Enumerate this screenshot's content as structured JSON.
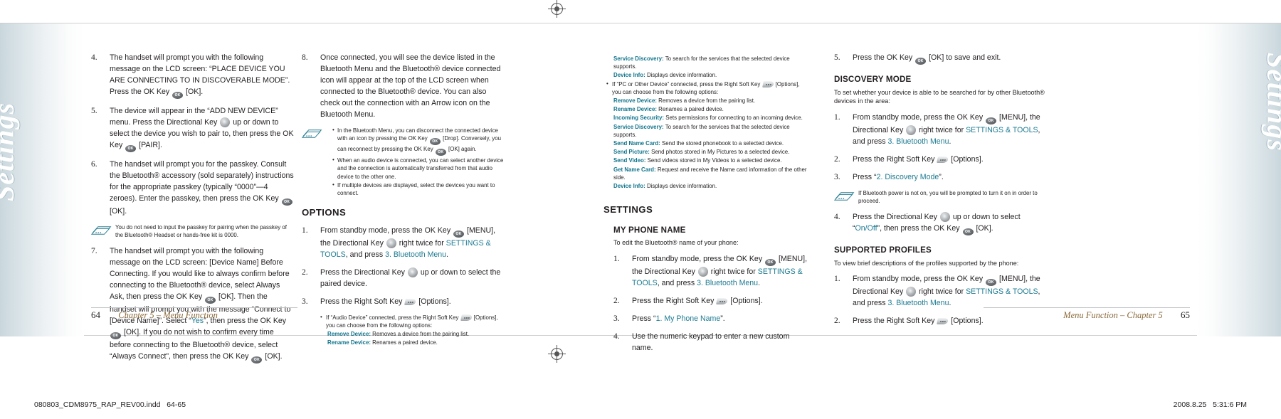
{
  "spread": {
    "side_tab_label": "Settings",
    "teal_color": "#1d7b92",
    "running_head_color": "#8a6a3b"
  },
  "slug": {
    "left": "080803_CDM8975_RAP_REV00.indd   64-65",
    "right": "2008.8.25   5:31:6 PM"
  },
  "footer": {
    "left_page_number": "64",
    "left_running_head": "Chapter 5 – Menu Function",
    "right_page_number": "65",
    "right_running_head": "Menu Function – Chapter 5"
  },
  "icons": {
    "ok_key": "ok-key-icon",
    "ok_key_label": "OK",
    "directional_key": "directional-key-icon",
    "right_soft_key": "right-soft-key-icon",
    "note": "note-pad-icon",
    "registration": "registration-mark-icon"
  },
  "column1": {
    "steps": [
      {
        "num": "4.",
        "parts": [
          {
            "t": "The handset will prompt you with the following message on the LCD screen: “PLACE DEVICE YOU ARE CONNECTING TO IN DISCOVERABLE MODE”. Press the OK Key "
          },
          {
            "icon": "ok"
          },
          {
            "t": " [OK]."
          }
        ]
      },
      {
        "num": "5.",
        "parts": [
          {
            "t": "The device will appear in the “ADD NEW DEVICE” menu. Press the Directional Key "
          },
          {
            "icon": "dir"
          },
          {
            "t": " up or down to select the device you wish to pair to, then press the OK Key "
          },
          {
            "icon": "ok"
          },
          {
            "t": " [PAIR]."
          }
        ]
      },
      {
        "num": "6.",
        "parts": [
          {
            "t": "The handset will prompt you for the passkey. Consult the Bluetooth® accessory (sold separately) instructions for the appropriate passkey (typically “0000”—4 zeroes). Enter the passkey, then press the OK Key "
          },
          {
            "icon": "ok"
          },
          {
            "t": " [OK]."
          }
        ]
      }
    ],
    "note": "You do not need to input the passkey for pairing when the passkey of the Bluetooth® Headset or hands-free kit is 0000.",
    "step7": {
      "num": "7.",
      "parts": [
        {
          "t": "The handset will prompt you with the following message on the LCD screen: [Device Name] Before Connecting. If you would like to always confirm before connecting to the Bluetooth® device, select Always Ask, then press the OK Key "
        },
        {
          "icon": "ok"
        },
        {
          "t": " [OK]. Then the handset will prompt you with the message “Connect to [Device Name]”. Select “"
        },
        {
          "teal": "Yes"
        },
        {
          "t": "”, then press the OK Key "
        },
        {
          "icon": "ok"
        },
        {
          "t": " [OK]. If you do not wish to confirm every time before connecting to the Bluetooth® device, select “Always Connect”, then press the OK Key "
        },
        {
          "icon": "ok"
        },
        {
          "t": " [OK]."
        }
      ]
    }
  },
  "column2": {
    "step8": {
      "num": "8.",
      "text": "Once connected, you will see the device listed in the Bluetooth Menu and the Bluetooth® device connected icon will appear at the top of the LCD screen when connected to the Bluetooth® device. You can also check out the connection with an Arrow icon on the Bluetooth Menu."
    },
    "notes": [
      [
        {
          "t": "In the Bluetooth Menu, you can disconnect the connected device with an icon by pressing the OK Key "
        },
        {
          "icon": "ok"
        },
        {
          "t": " [Drop]. Conversely, you can reconnect by pressing the OK Key "
        },
        {
          "icon": "ok"
        },
        {
          "t": " [OK] again."
        }
      ],
      [
        {
          "t": "When an audio device is connected, you can select another device and the connection is automatically transferred from that audio device to the other one."
        }
      ],
      [
        {
          "t": "If multiple devices are displayed, select the devices you want to connect."
        }
      ]
    ],
    "section_title": "OPTIONS",
    "steps": [
      {
        "num": "1.",
        "parts": [
          {
            "t": "From standby mode, press the OK Key "
          },
          {
            "icon": "ok"
          },
          {
            "t": " [MENU], the Directional Key "
          },
          {
            "icon": "dir"
          },
          {
            "t": " right twice for "
          },
          {
            "teal": "SETTINGS & TOOLS"
          },
          {
            "t": ", and press "
          },
          {
            "teal": "3. Bluetooth Menu"
          },
          {
            "t": "."
          }
        ]
      },
      {
        "num": "2.",
        "parts": [
          {
            "t": "Press the Directional Key "
          },
          {
            "icon": "dir"
          },
          {
            "t": " up or down to select the paired device."
          }
        ]
      },
      {
        "num": "3.",
        "parts": [
          {
            "t": "Press the Right Soft Key "
          },
          {
            "icon": "soft"
          },
          {
            "t": " [Options]."
          }
        ]
      }
    ],
    "sub_note_intro": [
      {
        "t": "If “Audio Device” connected, press the Right Soft Key "
      },
      {
        "icon": "soft"
      },
      {
        "t": " [Options], you can choose from the following options:"
      }
    ],
    "definitions": [
      {
        "term": "Remove Device:",
        "def": "Removes a device from the pairing list."
      },
      {
        "term": "Rename Device:",
        "def": "Renames a paired device."
      }
    ]
  },
  "column3": {
    "continued_definitions_top": [
      {
        "term": "Service Discovery:",
        "def": "To search for the services that the selected device supports."
      },
      {
        "term": "Device Info:",
        "def": "Displays device information."
      }
    ],
    "pc_note_intro": [
      {
        "t": "If “PC or Other Device” connected, press the Right Soft Key "
      },
      {
        "icon": "soft"
      },
      {
        "t": " [Options], you can choose from the following options:"
      }
    ],
    "pc_definitions": [
      {
        "term": "Remove Device:",
        "def": "Removes a device from the pairing list."
      },
      {
        "term": "Rename Device:",
        "def": "Renames a paired device."
      },
      {
        "term": "Incoming Security:",
        "def": "Sets permissions for connecting to an incoming device."
      },
      {
        "term": "Service Discovery:",
        "def": "To search for the services that the selected device supports."
      },
      {
        "term": "Send Name Card:",
        "def": "Send the stored phonebook to a selected device."
      },
      {
        "term": "Send Picture:",
        "def": "Send photos stored in My Pictures to a selected device."
      },
      {
        "term": "Send Video:",
        "def": "Send videos stored in My Videos to a selected device."
      },
      {
        "term": "Get Name Card:",
        "def": "Request and receive the Name card information of the other side."
      },
      {
        "term": "Device Info:",
        "def": "Displays device information."
      }
    ],
    "section_title": "SETTINGS",
    "subsection_title": "MY PHONE NAME",
    "subsection_lead": "To edit the Bluetooth® name of your phone:",
    "steps": [
      {
        "num": "1.",
        "parts": [
          {
            "t": "From standby mode, press the OK Key "
          },
          {
            "icon": "ok"
          },
          {
            "t": " [MENU], the Directional Key "
          },
          {
            "icon": "dir"
          },
          {
            "t": " right twice for "
          },
          {
            "teal": "SETTINGS & TOOLS"
          },
          {
            "t": ", and press "
          },
          {
            "teal": "3. Bluetooth Menu"
          },
          {
            "t": "."
          }
        ]
      },
      {
        "num": "2.",
        "parts": [
          {
            "t": "Press the Right Soft Key "
          },
          {
            "icon": "soft"
          },
          {
            "t": " [Options]."
          }
        ]
      },
      {
        "num": "3.",
        "parts": [
          {
            "t": "Press “"
          },
          {
            "teal": "1. My Phone Name"
          },
          {
            "t": "”."
          }
        ]
      },
      {
        "num": "4.",
        "parts": [
          {
            "t": "Use the numeric keypad to enter a new custom name."
          }
        ]
      }
    ]
  },
  "column4": {
    "step5": {
      "num": "5.",
      "parts": [
        {
          "t": "Press the OK Key "
        },
        {
          "icon": "ok"
        },
        {
          "t": " [OK] to save and exit."
        }
      ]
    },
    "discovery": {
      "title": "DISCOVERY MODE",
      "lead": "To set whether your device is able to be searched for by other Bluetooth® devices in the area:",
      "steps": [
        {
          "num": "1.",
          "parts": [
            {
              "t": "From standby mode, press the OK Key "
            },
            {
              "icon": "ok"
            },
            {
              "t": " [MENU], the Directional Key "
            },
            {
              "icon": "dir"
            },
            {
              "t": " right twice for "
            },
            {
              "teal": "SETTINGS & TOOLS"
            },
            {
              "t": ", and press "
            },
            {
              "teal": "3. Bluetooth Menu"
            },
            {
              "t": "."
            }
          ]
        },
        {
          "num": "2.",
          "parts": [
            {
              "t": "Press the Right Soft Key "
            },
            {
              "icon": "soft"
            },
            {
              "t": " [Options]."
            }
          ]
        },
        {
          "num": "3.",
          "parts": [
            {
              "t": "Press “"
            },
            {
              "teal": "2. Discovery Mode"
            },
            {
              "t": "”."
            }
          ]
        }
      ],
      "note": "If Bluetooth power is not on, you will be prompted to turn it on in order to proceed.",
      "step4": {
        "num": "4.",
        "parts": [
          {
            "t": "Press the Directional Key "
          },
          {
            "icon": "dir"
          },
          {
            "t": " up or down to select “"
          },
          {
            "teal": "On/Off"
          },
          {
            "t": "”, then press the OK Key "
          },
          {
            "icon": "ok"
          },
          {
            "t": " [OK]."
          }
        ]
      }
    },
    "profiles": {
      "title": "SUPPORTED PROFILES",
      "lead": "To view brief descriptions of the profiles supported by the phone:",
      "steps": [
        {
          "num": "1.",
          "parts": [
            {
              "t": "From standby mode, press the OK Key "
            },
            {
              "icon": "ok"
            },
            {
              "t": " [MENU], the Directional Key "
            },
            {
              "icon": "dir"
            },
            {
              "t": " right twice for "
            },
            {
              "teal": "SETTINGS & TOOLS"
            },
            {
              "t": ", and press "
            },
            {
              "teal": "3. Bluetooth Menu"
            },
            {
              "t": "."
            }
          ]
        },
        {
          "num": "2.",
          "parts": [
            {
              "t": "Press the Right Soft Key "
            },
            {
              "icon": "soft"
            },
            {
              "t": " [Options]."
            }
          ]
        }
      ]
    }
  }
}
